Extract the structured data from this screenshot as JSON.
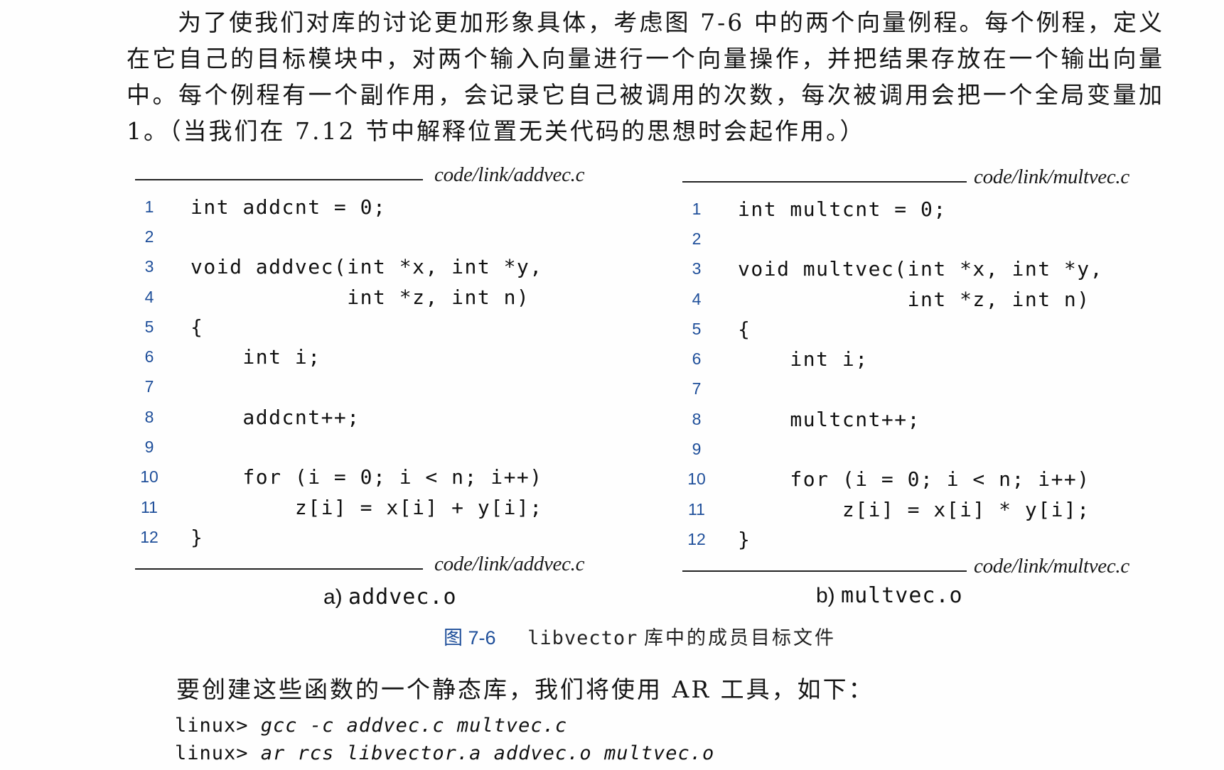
{
  "intro_paragraph": "为了使我们对库的讨论更加形象具体，考虑图 7-6 中的两个向量例程。每个例程，定义在它自己的目标模块中，对两个输入向量进行一个向量操作，并把结果存放在一个输出向量中。每个例程有一个副作用，会记录它自己被调用的次数，每次被调用会把一个全局变量加 1。（当我们在 7.12 节中解释位置无关代码的思想时会起作用。）",
  "listings": {
    "left": {
      "file_path": "code/link/addvec.c",
      "caption_prefix": "a)",
      "caption_name": "addvec.o",
      "lines": [
        {
          "num": "1",
          "code": "int addcnt = 0;"
        },
        {
          "num": "2",
          "code": ""
        },
        {
          "num": "3",
          "code": "void addvec(int *x, int *y,"
        },
        {
          "num": "4",
          "code": "            int *z, int n)"
        },
        {
          "num": "5",
          "code": "{"
        },
        {
          "num": "6",
          "code": "    int i;"
        },
        {
          "num": "7",
          "code": ""
        },
        {
          "num": "8",
          "code": "    addcnt++;"
        },
        {
          "num": "9",
          "code": ""
        },
        {
          "num": "10",
          "code": "    for (i = 0; i < n; i++)"
        },
        {
          "num": "11",
          "code": "        z[i] = x[i] + y[i];"
        },
        {
          "num": "12",
          "code": "}"
        }
      ]
    },
    "right": {
      "file_path": "code/link/multvec.c",
      "caption_prefix": "b)",
      "caption_name": "multvec.o",
      "lines": [
        {
          "num": "1",
          "code": "int multcnt = 0;"
        },
        {
          "num": "2",
          "code": ""
        },
        {
          "num": "3",
          "code": "void multvec(int *x, int *y,"
        },
        {
          "num": "4",
          "code": "             int *z, int n)"
        },
        {
          "num": "5",
          "code": "{"
        },
        {
          "num": "6",
          "code": "    int i;"
        },
        {
          "num": "7",
          "code": ""
        },
        {
          "num": "8",
          "code": "    multcnt++;"
        },
        {
          "num": "9",
          "code": ""
        },
        {
          "num": "10",
          "code": "    for (i = 0; i < n; i++)"
        },
        {
          "num": "11",
          "code": "        z[i] = x[i] * y[i];"
        },
        {
          "num": "12",
          "code": "}"
        }
      ]
    }
  },
  "figure_caption": {
    "label": "图 7-6",
    "mono": "libvector",
    "text": "库中的成员目标文件"
  },
  "after_paragraph": "要创建这些函数的一个静态库，我们将使用 AR 工具，如下：",
  "terminal": [
    {
      "prompt": "linux> ",
      "command": "gcc -c addvec.c multvec.c"
    },
    {
      "prompt": "linux> ",
      "command": "ar rcs libvector.a addvec.o multvec.o"
    }
  ],
  "colors": {
    "line_number": "#1f4f9a",
    "figure_label": "#1f4f9a",
    "text": "#161616"
  }
}
